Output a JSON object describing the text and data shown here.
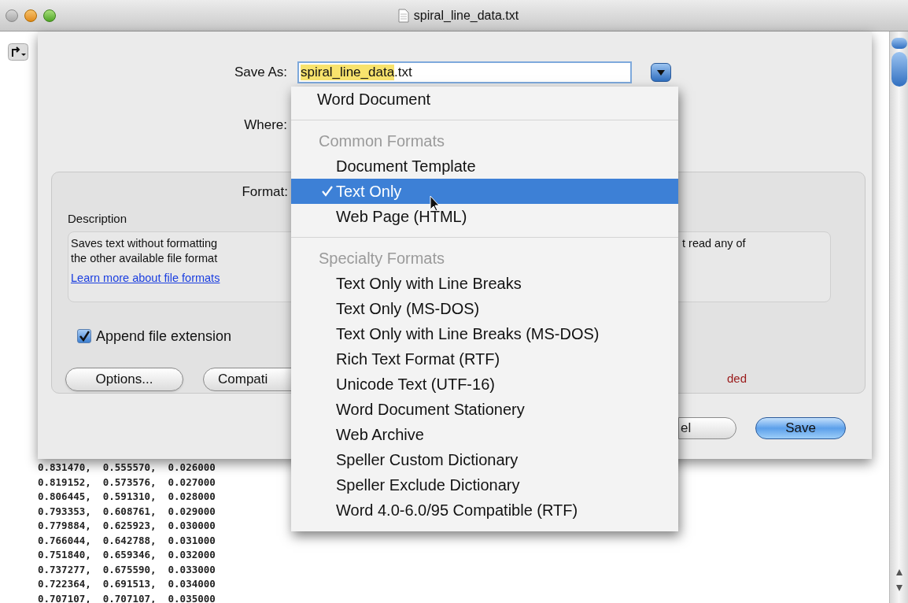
{
  "window": {
    "title": "spiral_line_data.txt"
  },
  "document": {
    "lines": [
      "0.831470,  0.555570,  0.026000",
      "0.819152,  0.573576,  0.027000",
      "0.806445,  0.591310,  0.028000",
      "0.793353,  0.608761,  0.029000",
      "0.779884,  0.625923,  0.030000",
      "0.766044,  0.642788,  0.031000",
      "0.751840,  0.659346,  0.032000",
      "0.737277,  0.675590,  0.033000",
      "0.722364,  0.691513,  0.034000",
      "0.707107,  0.707107,  0.035000"
    ]
  },
  "save_dialog": {
    "save_as": {
      "label": "Save As:",
      "value_parts": [
        {
          "text": "spiral_line_data",
          "selected": true
        },
        {
          "text": ".txt",
          "selected": false
        }
      ]
    },
    "where": {
      "label": "Where:"
    },
    "format": {
      "label": "Format:"
    },
    "description": {
      "title": "Description",
      "lines": [
        {
          "left": "Saves text without formatting",
          "right": "t read any of"
        },
        {
          "left": "the other available file format"
        }
      ],
      "link": "Learn more about file formats"
    },
    "append_extension": {
      "label": "Append file extension",
      "checked": true
    },
    "options_button": "Options...",
    "compatibility_button": "Compati",
    "compatibility_note": "ded",
    "cancel_button": "el",
    "save_button": "Save"
  },
  "format_menu": {
    "groups": [
      {
        "items": [
          {
            "label": "Word Document",
            "selected": false
          }
        ]
      },
      {
        "header": "Common Formats",
        "items": [
          {
            "label": "Document Template",
            "selected": false
          },
          {
            "label": "Text Only",
            "selected": true
          },
          {
            "label": "Web Page (HTML)",
            "selected": false
          }
        ]
      },
      {
        "header": "Specialty Formats",
        "items": [
          {
            "label": "Text Only with Line Breaks",
            "selected": false
          },
          {
            "label": "Text Only (MS-DOS)",
            "selected": false
          },
          {
            "label": "Text Only with Line Breaks (MS-DOS)",
            "selected": false
          },
          {
            "label": "Rich Text Format (RTF)",
            "selected": false
          },
          {
            "label": "Unicode Text (UTF-16)",
            "selected": false
          },
          {
            "label": "Word Document Stationery",
            "selected": false
          },
          {
            "label": "Web Archive",
            "selected": false
          },
          {
            "label": "Speller Custom Dictionary",
            "selected": false
          },
          {
            "label": "Speller Exclude Dictionary",
            "selected": false
          },
          {
            "label": "Word 4.0-6.0/95 Compatible (RTF)",
            "selected": false
          }
        ]
      }
    ]
  }
}
